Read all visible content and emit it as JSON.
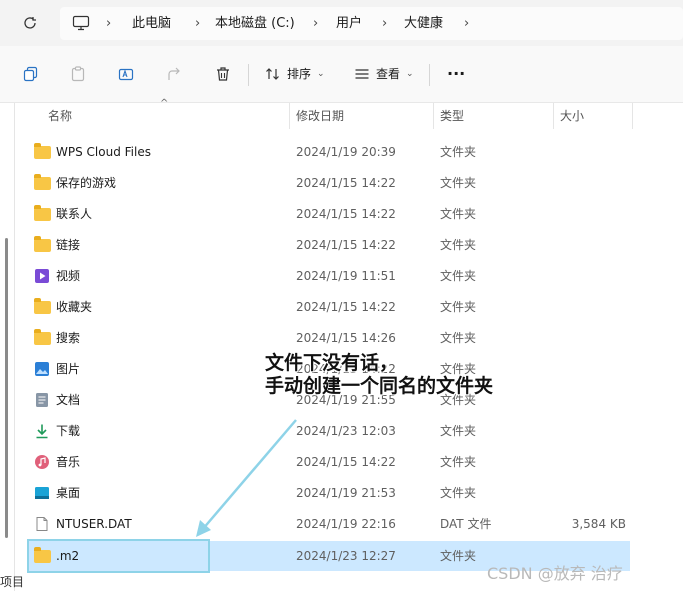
{
  "breadcrumb": [
    "此电脑",
    "本地磁盘 (C:)",
    "用户",
    "大健康"
  ],
  "toolbar": {
    "sort_label": "排序",
    "view_label": "查看",
    "more": "···"
  },
  "columns": {
    "name": "名称",
    "date": "修改日期",
    "type": "类型",
    "size": "大小"
  },
  "files": [
    {
      "name": "WPS Cloud Files",
      "date": "2024/1/19 20:39",
      "type": "文件夹",
      "size": "",
      "icon": "folder-icon"
    },
    {
      "name": "保存的游戏",
      "date": "2024/1/15 14:22",
      "type": "文件夹",
      "size": "",
      "icon": "folder-icon"
    },
    {
      "name": "联系人",
      "date": "2024/1/15 14:22",
      "type": "文件夹",
      "size": "",
      "icon": "folder-icon"
    },
    {
      "name": "链接",
      "date": "2024/1/15 14:22",
      "type": "文件夹",
      "size": "",
      "icon": "folder-icon"
    },
    {
      "name": "视频",
      "date": "2024/1/19 11:51",
      "type": "文件夹",
      "size": "",
      "icon": "videos-folder-icon"
    },
    {
      "name": "收藏夹",
      "date": "2024/1/15 14:22",
      "type": "文件夹",
      "size": "",
      "icon": "folder-icon"
    },
    {
      "name": "搜索",
      "date": "2024/1/15 14:26",
      "type": "文件夹",
      "size": "",
      "icon": "folder-icon"
    },
    {
      "name": "图片",
      "date": "2024/1/15 14:22",
      "type": "文件夹",
      "size": "",
      "icon": "pictures-folder-icon"
    },
    {
      "name": "文档",
      "date": "2024/1/19 21:55",
      "type": "文件夹",
      "size": "",
      "icon": "documents-folder-icon"
    },
    {
      "name": "下载",
      "date": "2024/1/23 12:03",
      "type": "文件夹",
      "size": "",
      "icon": "downloads-folder-icon"
    },
    {
      "name": "音乐",
      "date": "2024/1/15 14:22",
      "type": "文件夹",
      "size": "",
      "icon": "music-folder-icon"
    },
    {
      "name": "桌面",
      "date": "2024/1/19 21:53",
      "type": "文件夹",
      "size": "",
      "icon": "desktop-folder-icon"
    },
    {
      "name": "NTUSER.DAT",
      "date": "2024/1/19 22:16",
      "type": "DAT 文件",
      "size": "3,584 KB",
      "icon": "file-icon"
    },
    {
      "name": ".m2",
      "date": "2024/1/23 12:27",
      "type": "文件夹",
      "size": "",
      "icon": "folder-icon",
      "selected": true
    }
  ],
  "annotation": {
    "line1": "文件下没有话，",
    "line2": "手动创建一个同名的文件夹"
  },
  "watermark": "CSDN @放弃     治疗",
  "status": {
    "items": "项目"
  },
  "colors": {
    "selection": "#cce8ff",
    "folder": "#f8c645",
    "arrow": "#8ed3e8"
  }
}
